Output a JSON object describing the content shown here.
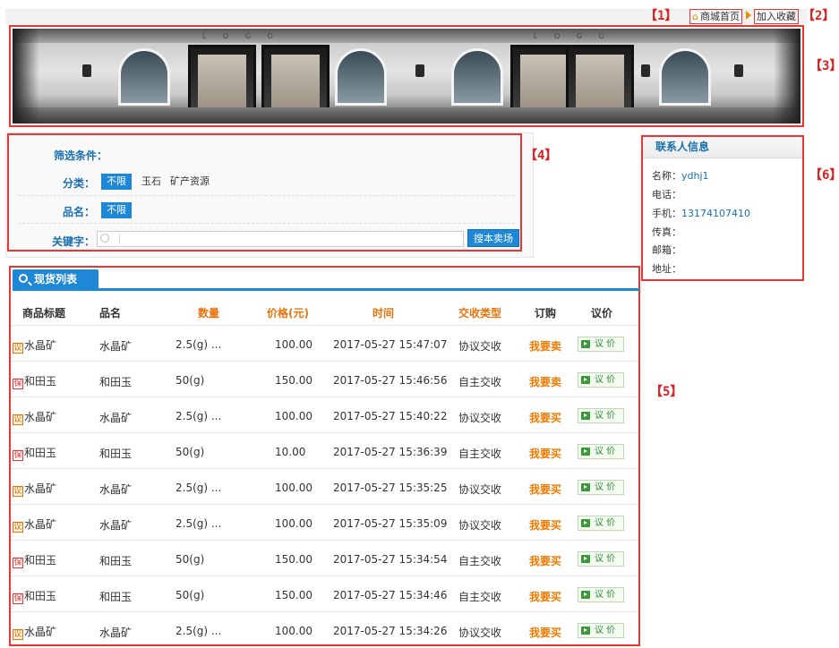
{
  "annotations": [
    "【1】",
    "【2】",
    "【3】",
    "【4】",
    "【5】",
    "【6】"
  ],
  "nav": {
    "home_label": "商城首页",
    "favorite_label": "加入收藏"
  },
  "banner": {
    "sign_text": "L O G O"
  },
  "filter": {
    "title": "筛选条件：",
    "category_label": "分类：",
    "category_options": [
      "不限",
      "玉石",
      "矿产资源"
    ],
    "name_label": "品名：",
    "name_options": [
      "不限"
    ],
    "keyword_label": "关键字：",
    "keyword_value": "",
    "search_button": "搜本卖场"
  },
  "contact": {
    "title": "联系人信息",
    "name_label": "名称：",
    "name_value": "ydhj1",
    "phone_label": "电话：",
    "phone_value": "",
    "mobile_label": "手机：",
    "mobile_value": "13174107410",
    "fax_label": "传真：",
    "fax_value": "",
    "email_label": "邮箱：",
    "email_value": "",
    "address_label": "地址：",
    "address_value": ""
  },
  "list": {
    "tab_label": "现货列表",
    "headers": [
      "商品标题",
      "品名",
      "数量",
      "价格(元)",
      "时间",
      "交收类型",
      "订购",
      "议价"
    ],
    "rows": [
      {
        "badge": "议",
        "badge_type": "yi",
        "title": "水晶矿",
        "name": "水晶矿",
        "qty": "2.5(g) ...",
        "price": "100.00",
        "time": "2017-05-27 15:47:07",
        "type": "协议交收",
        "action": "我要卖",
        "negotiate": "议 价"
      },
      {
        "badge": "保",
        "badge_type": "bao",
        "title": "和田玉",
        "name": "和田玉",
        "qty": "50(g)",
        "price": "150.00",
        "time": "2017-05-27 15:46:56",
        "type": "自主交收",
        "action": "我要卖",
        "negotiate": "议 价"
      },
      {
        "badge": "议",
        "badge_type": "yi",
        "title": "水晶矿",
        "name": "水晶矿",
        "qty": "2.5(g) ...",
        "price": "100.00",
        "time": "2017-05-27 15:40:22",
        "type": "协议交收",
        "action": "我要买",
        "negotiate": "议 价"
      },
      {
        "badge": "保",
        "badge_type": "bao",
        "title": "和田玉",
        "name": "和田玉",
        "qty": "50(g)",
        "price": "10.00",
        "time": "2017-05-27 15:36:39",
        "type": "自主交收",
        "action": "我要买",
        "negotiate": "议 价"
      },
      {
        "badge": "议",
        "badge_type": "yi",
        "title": "水晶矿",
        "name": "水晶矿",
        "qty": "2.5(g) ...",
        "price": "100.00",
        "time": "2017-05-27 15:35:25",
        "type": "协议交收",
        "action": "我要买",
        "negotiate": "议 价"
      },
      {
        "badge": "议",
        "badge_type": "yi",
        "title": "水晶矿",
        "name": "水晶矿",
        "qty": "2.5(g) ...",
        "price": "100.00",
        "time": "2017-05-27 15:35:09",
        "type": "协议交收",
        "action": "我要买",
        "negotiate": "议 价"
      },
      {
        "badge": "保",
        "badge_type": "bao",
        "title": "和田玉",
        "name": "和田玉",
        "qty": "50(g)",
        "price": "150.00",
        "time": "2017-05-27 15:34:54",
        "type": "自主交收",
        "action": "我要买",
        "negotiate": "议 价"
      },
      {
        "badge": "保",
        "badge_type": "bao",
        "title": "和田玉",
        "name": "和田玉",
        "qty": "50(g)",
        "price": "150.00",
        "time": "2017-05-27 15:34:46",
        "type": "自主交收",
        "action": "我要买",
        "negotiate": "议 价"
      },
      {
        "badge": "议",
        "badge_type": "yi",
        "title": "水晶矿",
        "name": "水晶矿",
        "qty": "2.5(g) ...",
        "price": "100.00",
        "time": "2017-05-27 15:34:26",
        "type": "协议交收",
        "action": "我要买",
        "negotiate": "议 价"
      }
    ]
  },
  "colors": {
    "accent": "#1f88d6",
    "annotation": "#e33333",
    "action": "#f07a00",
    "label": "#1a6fb0"
  },
  "icons": {
    "home": "home-icon",
    "search": "search-icon",
    "negotiate": "negotiate-icon"
  }
}
